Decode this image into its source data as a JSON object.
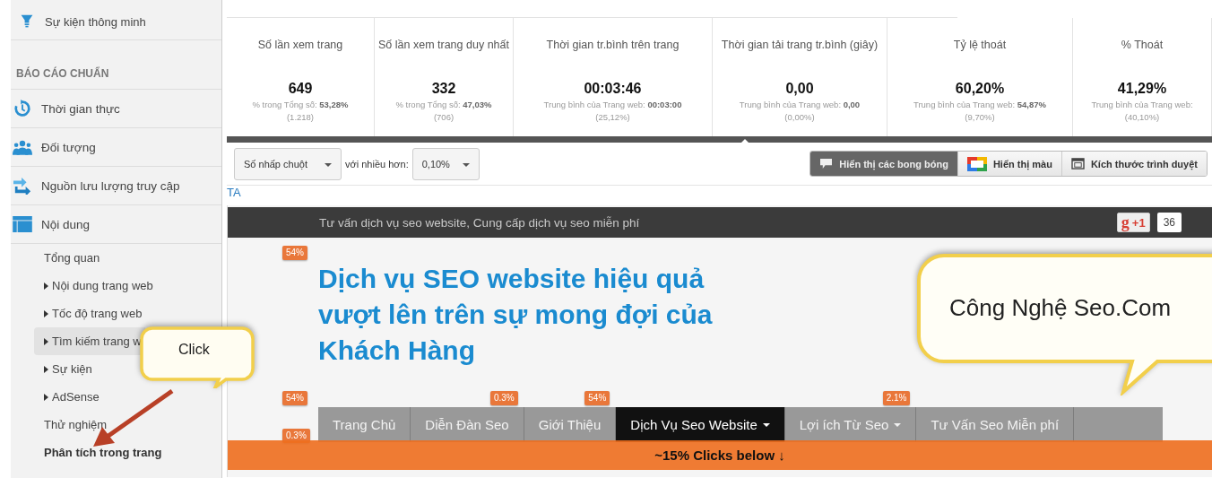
{
  "sidebar": {
    "top_item": {
      "label": "Sự kiện thông minh"
    },
    "section_title": "BÁO CÁO CHUẨN",
    "items": [
      {
        "label": "Thời gian thực"
      },
      {
        "label": "Đối tượng"
      },
      {
        "label": "Nguồn lưu lượng truy cập"
      },
      {
        "label": "Nội dung"
      }
    ],
    "sub_items": [
      {
        "label": "Tổng quan",
        "expandable": false,
        "hovered": false,
        "selected": false
      },
      {
        "label": "Nội dung trang web",
        "expandable": true,
        "hovered": false,
        "selected": false
      },
      {
        "label": "Tốc độ trang web",
        "expandable": true,
        "hovered": false,
        "selected": false
      },
      {
        "label": "Tìm kiếm trang w",
        "expandable": true,
        "hovered": true,
        "selected": false
      },
      {
        "label": "Sự kiện",
        "expandable": true,
        "hovered": false,
        "selected": false
      },
      {
        "label": "AdSense",
        "expandable": true,
        "hovered": false,
        "selected": false
      },
      {
        "label": "Thử nghiệm",
        "expandable": false,
        "hovered": false,
        "selected": false
      },
      {
        "label": "Phân tích trong trang",
        "expandable": false,
        "hovered": false,
        "selected": true
      }
    ]
  },
  "metrics": [
    {
      "title": "Số lần xem trang",
      "value": "649",
      "note": "% trong Tổng số: **53,28%**",
      "sub": "(1.218)"
    },
    {
      "title": "Số lần xem trang duy nhất",
      "value": "332",
      "note": "% trong Tổng số: **47,03%**",
      "sub": "(706)"
    },
    {
      "title": "Thời gian tr.bình trên trang",
      "value": "00:03:46",
      "note": "Trung bình của Trang web: **00:03:00**",
      "sub": "(25,12%)"
    },
    {
      "title": "Thời gian tải trang tr.bình (giây)",
      "value": "0,00",
      "note": "Trung bình của Trang web: **0,00**",
      "sub": "(0,00%)"
    },
    {
      "title": "Tỷ lệ thoát",
      "value": "60,20%",
      "note": "Trung bình của Trang web: **54,87%**",
      "sub": "(9,70%)"
    },
    {
      "title": "% Thoát",
      "value": "41,29%",
      "note": "Trung bình của Trang web:",
      "sub": "(40,10%)"
    }
  ],
  "toolbar": {
    "metric_select": "Số nhấp chuột",
    "threshold_label": "với nhiều hơn:",
    "threshold_select": "0,10%",
    "view_buttons": [
      {
        "label": "Hiển thị các bong bóng",
        "selected": true
      },
      {
        "label": "Hiển thị màu",
        "selected": false
      },
      {
        "label": "Kích thước trình duyệt",
        "selected": false
      }
    ]
  },
  "frame_label": "TA",
  "site": {
    "tagline": "Tư vấn dịch vụ seo website, Cung cấp dịch vụ seo miễn phí",
    "plus_one": {
      "logo": "g",
      "label": "+1",
      "count": "36"
    },
    "heading": "Dịch vụ SEO website hiệu quả vượt lên trên sự mong đợi của Khách Hàng",
    "heading_badge": "54%",
    "menu": [
      {
        "label": "Trang Chủ",
        "selected": false,
        "dropdown": false,
        "badge": "54%"
      },
      {
        "label": "Diễn Đàn Seo",
        "selected": false,
        "dropdown": false,
        "badge": "0.3%"
      },
      {
        "label": "Giới Thiệu",
        "selected": false,
        "dropdown": false,
        "badge": "54%"
      },
      {
        "label": "Dịch Vụ Seo Website",
        "selected": true,
        "dropdown": true
      },
      {
        "label": "Lợi ích Từ Seo",
        "selected": false,
        "dropdown": true,
        "badge": "2.1%"
      },
      {
        "label": "Tư Vấn Seo Miễn phí",
        "selected": false,
        "dropdown": false
      }
    ],
    "second_row_badge": "0.3%",
    "below_bar": "~15% Clicks below ↓"
  },
  "callouts": [
    {
      "kind": "small",
      "text": "Click"
    },
    {
      "kind": "large",
      "text": "Công Nghệ Seo.Com"
    }
  ]
}
